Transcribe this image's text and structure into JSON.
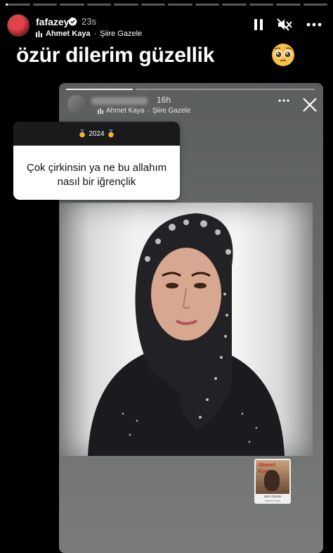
{
  "story": {
    "username": "fafazey",
    "time": "23s",
    "music_artist": "Ahmet Kaya",
    "music_separator": "·",
    "music_title": "Şiire Gazele",
    "caption": "özür dilerim güzellik",
    "caption_emoji": "pleading-face-emoji"
  },
  "controls": {
    "pause_icon": "pause-icon",
    "mute_icon": "speaker-muted-icon",
    "more_icon": "more-icon"
  },
  "reshared": {
    "time": "16h",
    "music_artist": "Ahmet Kaya",
    "music_title": "Şiire Gazele",
    "question": {
      "header": "2024",
      "header_icon": "medal-icon",
      "text": "Çok çirkinsin ya ne bu allahım\nnasıl  bir iğrençlik"
    },
    "sticker": {
      "album_title": "Ahmet Kaya",
      "song": "Şiire Gazele",
      "artist": "Ahmet Kaya"
    }
  },
  "colors": {
    "background": "#000000",
    "card": "#6a6c6d",
    "question_header": "#1a1a1a",
    "avatar_red": "#e0444a"
  }
}
